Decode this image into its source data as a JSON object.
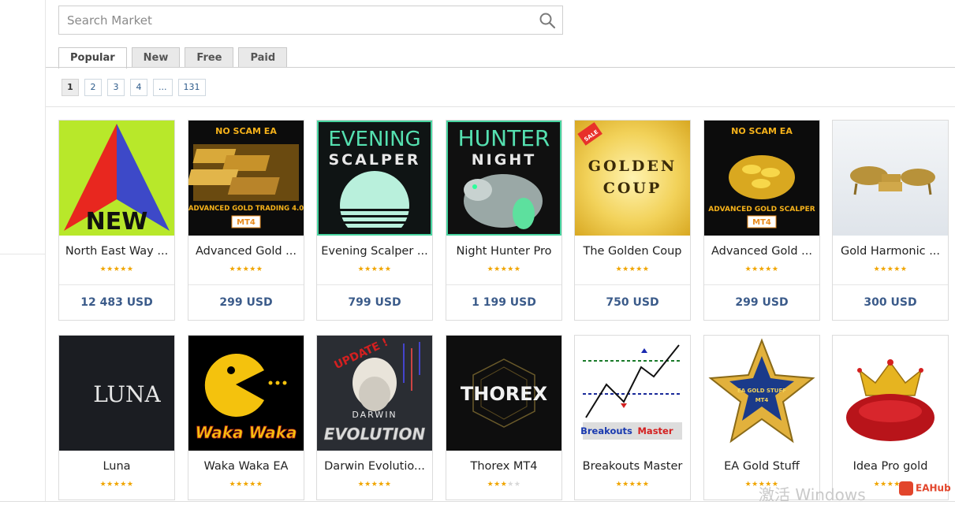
{
  "search": {
    "placeholder": "Search Market"
  },
  "tabs": [
    {
      "label": "Popular",
      "active": true
    },
    {
      "label": "New",
      "active": false
    },
    {
      "label": "Free",
      "active": false
    },
    {
      "label": "Paid",
      "active": false
    }
  ],
  "pagination": [
    "1",
    "2",
    "3",
    "4",
    "...",
    "131"
  ],
  "products": [
    {
      "name": "North East Way ...",
      "rating": 4.5,
      "price": "12 483 USD",
      "icon": "arrow-new-icon"
    },
    {
      "name": "Advanced Gold ...",
      "rating": 5,
      "price": "299 USD",
      "icon": "gold-bars-icon",
      "img_text": {
        "top": "NO SCAM EA",
        "bottom": "ADVANCED GOLD TRADING 4.0",
        "tag": "MT4"
      }
    },
    {
      "name": "Evening Scalper ...",
      "rating": 5,
      "price": "799 USD",
      "icon": "evening-scalper-icon",
      "img_text": {
        "line1": "EVENING",
        "line2": "SCALPER"
      }
    },
    {
      "name": "Night Hunter Pro",
      "rating": 5,
      "price": "1 199 USD",
      "icon": "hunter-night-icon",
      "img_text": {
        "line1": "HUNTER",
        "line2": "NIGHT"
      }
    },
    {
      "name": "The Golden Coup",
      "rating": 4.5,
      "price": "750 USD",
      "icon": "golden-coup-icon",
      "img_text": {
        "line1": "GOLDEN",
        "line2": "COUP",
        "tag": "SALE"
      }
    },
    {
      "name": "Advanced Gold ...",
      "rating": 5,
      "price": "299 USD",
      "icon": "gold-coins-icon",
      "img_text": {
        "top": "NO SCAM EA",
        "bottom": "ADVANCED GOLD SCALPER",
        "tag": "MT4"
      }
    },
    {
      "name": "Gold Harmonic ...",
      "rating": 4.5,
      "price": "300 USD",
      "icon": "gold-bull-icon"
    },
    {
      "name": "Luna",
      "rating": 5,
      "icon": "luna-icon",
      "img_text": {
        "line1": "LUNA"
      }
    },
    {
      "name": "Waka Waka EA",
      "rating": 4.5,
      "icon": "pacman-icon",
      "img_text": {
        "line1": "Waka Waka"
      }
    },
    {
      "name": "Darwin Evolutio...",
      "rating": 5,
      "icon": "darwin-icon",
      "img_text": {
        "line1": "DARWIN",
        "line2": "EVOLUTION",
        "tag": "UPDATE !"
      }
    },
    {
      "name": "Thorex MT4",
      "rating": 3.5,
      "icon": "thorex-icon",
      "img_text": {
        "line1": "THOREX"
      }
    },
    {
      "name": "Breakouts Master",
      "rating": 5,
      "icon": "breakout-chart-icon",
      "img_text": {
        "line1": "Breakouts",
        "line2": "Master"
      }
    },
    {
      "name": "EA Gold Stuff",
      "rating": 4.5,
      "icon": "gold-star-icon",
      "img_text": {
        "line1": "EA GOLD STUFF",
        "line2": "MT4"
      }
    },
    {
      "name": "Idea Pro gold",
      "rating": 5,
      "icon": "crown-icon"
    }
  ],
  "overlay": {
    "watermark": "激活 Windows",
    "brand": "EAHub"
  },
  "colors": {
    "accent": "#3b5b8a",
    "star": "#f0a500",
    "tab_bg": "#e9e9e9"
  }
}
